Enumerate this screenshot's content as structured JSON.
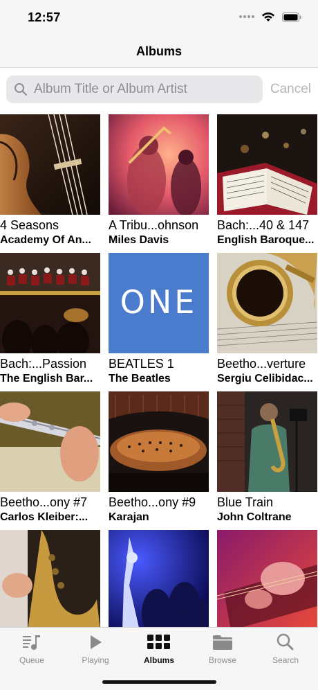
{
  "status_bar": {
    "time": "12:57"
  },
  "nav": {
    "title": "Albums"
  },
  "search": {
    "placeholder": "Album Title or Album Artist",
    "value": "",
    "cancel_label": "Cancel"
  },
  "albums": [
    {
      "title": "4 Seasons",
      "artist": "Academy Of An...",
      "cover": "violin"
    },
    {
      "title": "A Tribu...ohnson",
      "artist": "Miles Davis",
      "cover": "trombone-stage"
    },
    {
      "title": "Bach:...40 & 147",
      "artist": "English Baroque...",
      "cover": "sheet-music"
    },
    {
      "title": "Bach:...Passion",
      "artist": "The English Bar...",
      "cover": "choir"
    },
    {
      "title": "BEATLES 1",
      "artist": "The Beatles",
      "cover": "one",
      "cover_text": "ONE"
    },
    {
      "title": "Beetho...verture",
      "artist": "Sergiu Celibidac...",
      "cover": "saxophone-bell"
    },
    {
      "title": "Beetho...ony #7",
      "artist": "Carlos Kleiber:...",
      "cover": "flute"
    },
    {
      "title": "Beetho...ony #9",
      "artist": "Karajan",
      "cover": "concert-hall"
    },
    {
      "title": "Blue Train",
      "artist": "John Coltrane",
      "cover": "sax-player"
    },
    {
      "title": "",
      "artist": "",
      "cover": "sax-closeup"
    },
    {
      "title": "",
      "artist": "",
      "cover": "concert-crowd"
    },
    {
      "title": "",
      "artist": "",
      "cover": "guitar-red"
    }
  ],
  "tabs": [
    {
      "label": "Queue",
      "icon": "queue-icon",
      "active": false
    },
    {
      "label": "Playing",
      "icon": "play-icon",
      "active": false
    },
    {
      "label": "Albums",
      "icon": "albums-grid-icon",
      "active": true
    },
    {
      "label": "Browse",
      "icon": "folder-icon",
      "active": false
    },
    {
      "label": "Search",
      "icon": "search-icon",
      "active": false
    }
  ],
  "colors": {
    "accent": "#111111",
    "inactive_tab": "#8a8a8a",
    "one_cover": "#4a7bcc"
  }
}
